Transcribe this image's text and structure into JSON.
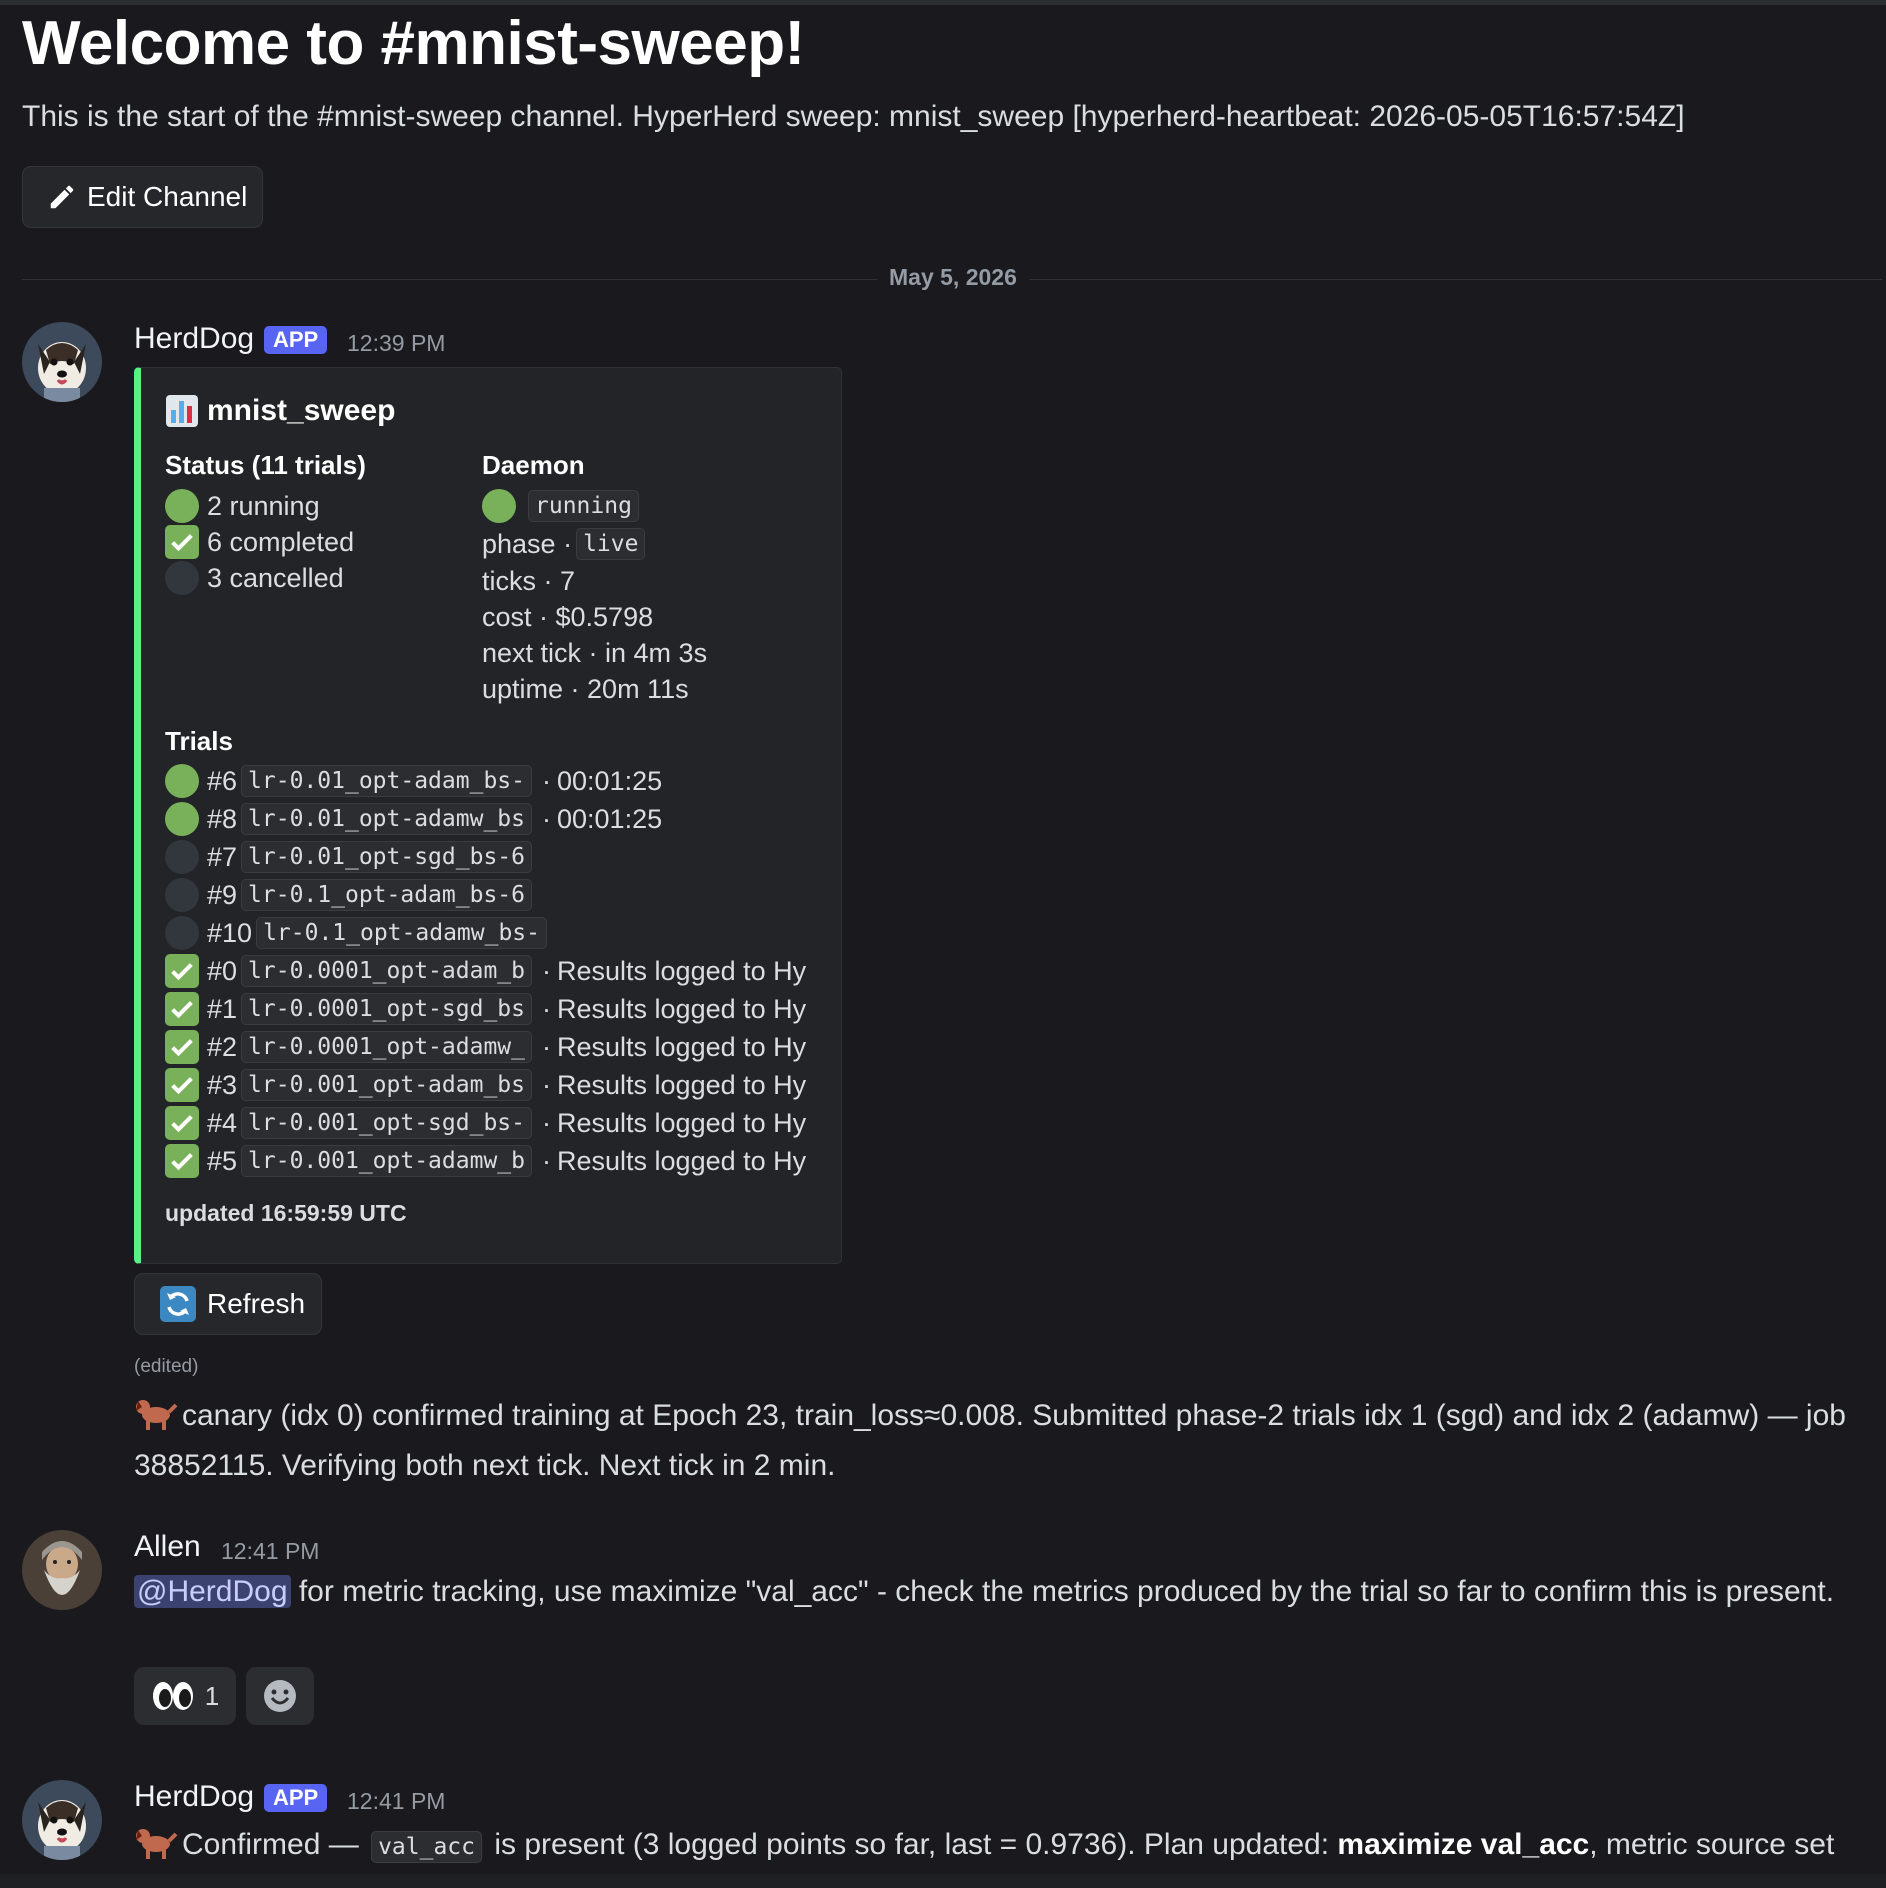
{
  "channel": {
    "welcome_title": "Welcome to #mnist-sweep!",
    "description": "This is the start of the #mnist-sweep channel. HyperHerd sweep: mnist_sweep [hyperherd-heartbeat: 2026-05-05T16:57:54Z]",
    "edit_button": "Edit Channel",
    "date_divider": "May 5, 2026"
  },
  "messages": [
    {
      "author": "HerdDog",
      "badge": "APP",
      "time": "12:39 PM",
      "embed": {
        "title": "mnist_sweep",
        "accent_color": "#57f287",
        "status": {
          "heading": "Status (11 trials)",
          "lines": [
            "2 running",
            "6 completed",
            "3 cancelled"
          ]
        },
        "daemon": {
          "heading": "Daemon",
          "state": "running",
          "phase_label": "phase ·",
          "phase": "live",
          "ticks": "ticks · 7",
          "cost": "cost · $0.5798",
          "next_tick": "next tick · in 4m 3s",
          "uptime": "uptime · 20m 11s"
        },
        "trials": {
          "heading": "Trials",
          "rows": [
            {
              "id": "#6",
              "name": "lr-0.01_opt-adam_bs-",
              "status": "running",
              "info": "00:01:25"
            },
            {
              "id": "#8",
              "name": "lr-0.01_opt-adamw_bs",
              "status": "running",
              "info": "00:01:25"
            },
            {
              "id": "#7",
              "name": "lr-0.01_opt-sgd_bs-6",
              "status": "cancelled",
              "info": ""
            },
            {
              "id": "#9",
              "name": "lr-0.1_opt-adam_bs-6",
              "status": "cancelled",
              "info": ""
            },
            {
              "id": "#10",
              "name": "lr-0.1_opt-adamw_bs-",
              "status": "cancelled",
              "info": ""
            },
            {
              "id": "#0",
              "name": "lr-0.0001_opt-adam_b",
              "status": "completed",
              "info": "Results logged to Hy"
            },
            {
              "id": "#1",
              "name": "lr-0.0001_opt-sgd_bs",
              "status": "completed",
              "info": "Results logged to Hy"
            },
            {
              "id": "#2",
              "name": "lr-0.0001_opt-adamw_",
              "status": "completed",
              "info": "Results logged to Hy"
            },
            {
              "id": "#3",
              "name": "lr-0.001_opt-adam_bs",
              "status": "completed",
              "info": "Results logged to Hy"
            },
            {
              "id": "#4",
              "name": "lr-0.001_opt-sgd_bs-",
              "status": "completed",
              "info": "Results logged to Hy"
            },
            {
              "id": "#5",
              "name": "lr-0.001_opt-adamw_b",
              "status": "completed",
              "info": "Results logged to Hy"
            }
          ]
        },
        "updated": "updated 16:59:59 UTC"
      },
      "refresh_button": "Refresh",
      "edited": "(edited)",
      "text": "canary (idx 0) confirmed training at Epoch 23, train_loss≈0.008. Submitted phase-2 trials idx 1 (sgd) and idx 2 (adamw) — job 38852115. Verifying both next tick. Next tick in 2 min."
    },
    {
      "author": "Allen",
      "time": "12:41 PM",
      "mention": "@HerdDog",
      "text": " for metric tracking, use maximize \"val_acc\" - check the metrics produced by the trial so far to confirm this is present.",
      "reaction_count": "1"
    },
    {
      "author": "HerdDog",
      "badge": "APP",
      "time": "12:41 PM",
      "text_pre": "Confirmed — ",
      "code": "val_acc",
      "text_mid": " is present (3 logged points so far, last = 0.9736). Plan updated: ",
      "bold": "maximize val_acc",
      "text_post": ", metric source set"
    }
  ]
}
